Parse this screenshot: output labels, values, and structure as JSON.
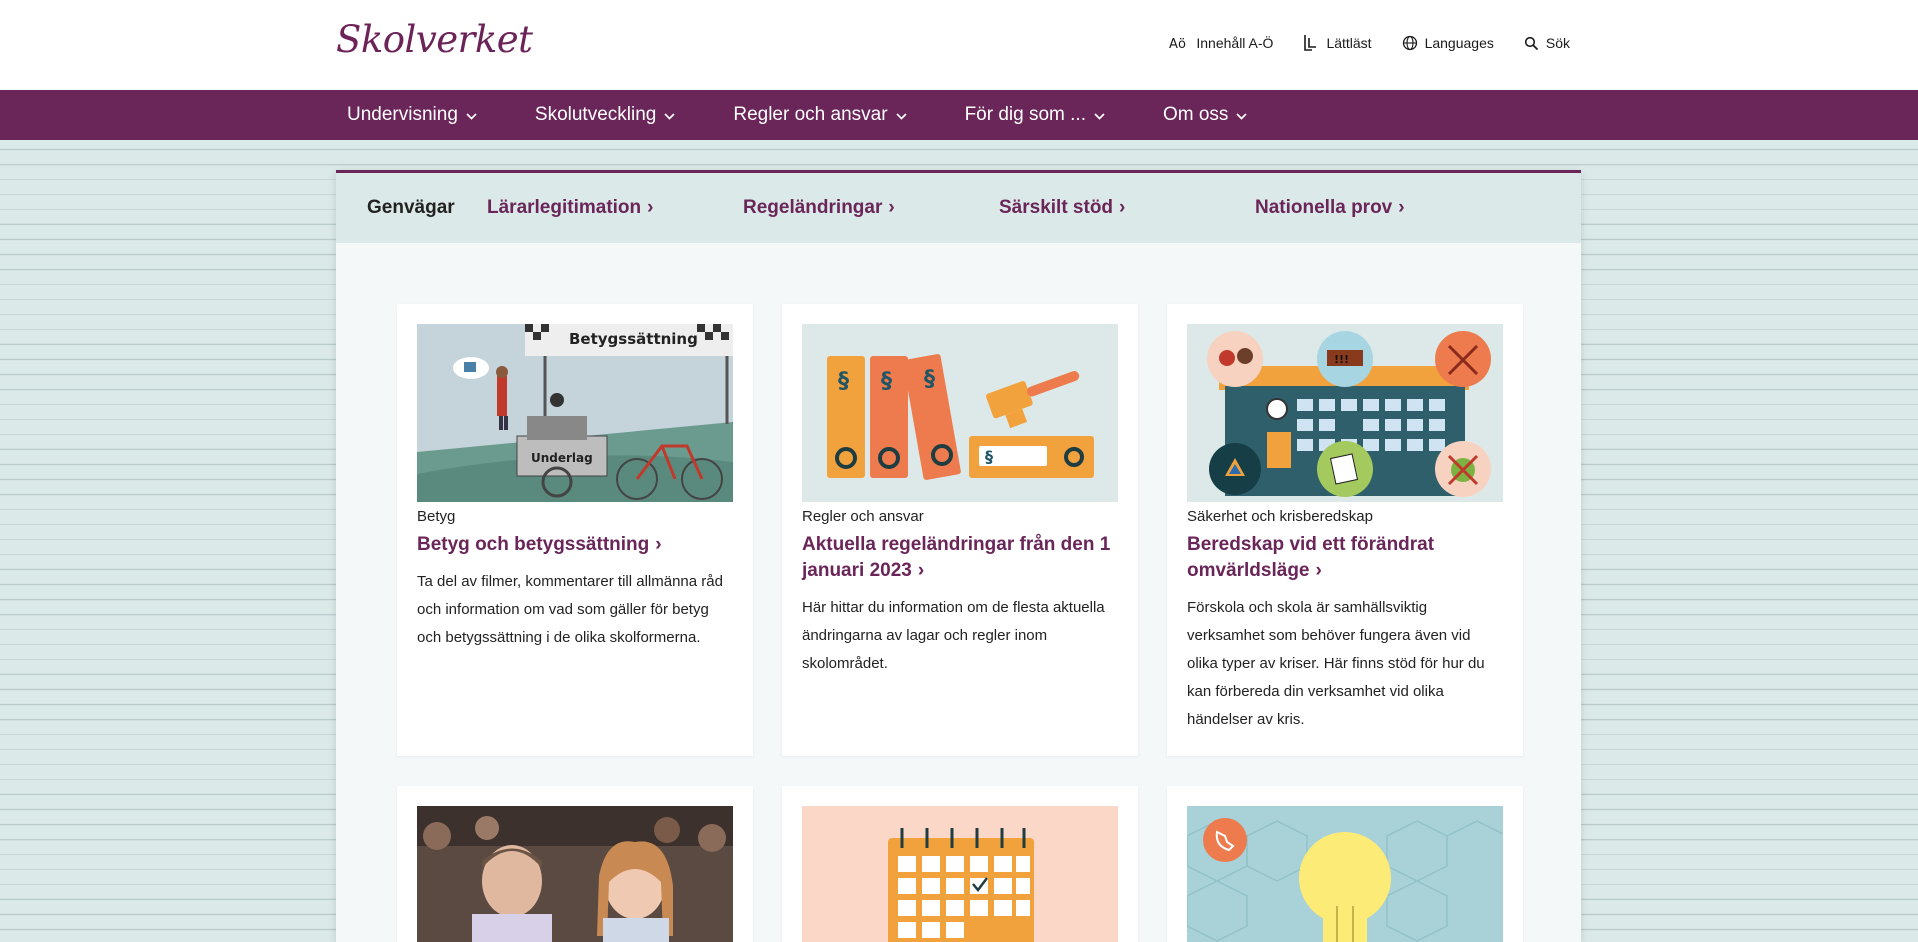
{
  "header": {
    "logo_text": "Skolverket",
    "tools": [
      {
        "label": "Innehåll A-Ö",
        "icon": "a-o-icon"
      },
      {
        "label": "Lättläst",
        "icon": "easy-read-icon"
      },
      {
        "label": "Languages",
        "icon": "globe-icon"
      },
      {
        "label": "Sök",
        "icon": "search-icon"
      }
    ]
  },
  "nav": {
    "items": [
      "Undervisning",
      "Skolutveckling",
      "Regler och ansvar",
      "För dig som ...",
      "Om oss"
    ]
  },
  "shortcuts": {
    "label": "Genvägar",
    "links": [
      "Lärarlegitimation",
      "Regeländringar",
      "Särskilt stöd",
      "Nationella prov"
    ],
    "chevron": "›"
  },
  "cards": [
    {
      "category": "Betyg",
      "title": "Betyg och betygssättning",
      "description": "Ta del av filmer, kommentarer till allmänna råd och information om vad som gäller för betyg och betygssättning i de olika skolformerna.",
      "image_banner": "Betygssättning",
      "image_cart_label": "Underlag"
    },
    {
      "category": "Regler och ansvar",
      "title": "Aktuella regeländringar från den 1 januari 2023",
      "description": "Här hittar du information om de flesta aktuella ändringarna av lagar och regler inom skolområdet.",
      "image_symbol": "§"
    },
    {
      "category": "Säkerhet och krisberedskap",
      "title": "Beredskap vid ett förändrat omvärldsläge",
      "description": "Förskola och skola är samhällsviktig verksamhet som behöver fungera även vid olika typer av kriser. Här finns stöd för hur du kan förbereda din verksamhet vid olika händelser av kris.",
      "image_sign": "!!!"
    }
  ],
  "colors": {
    "brand": "#6a2559",
    "background": "#dbe9e8",
    "panel": "#f4f8f8"
  }
}
